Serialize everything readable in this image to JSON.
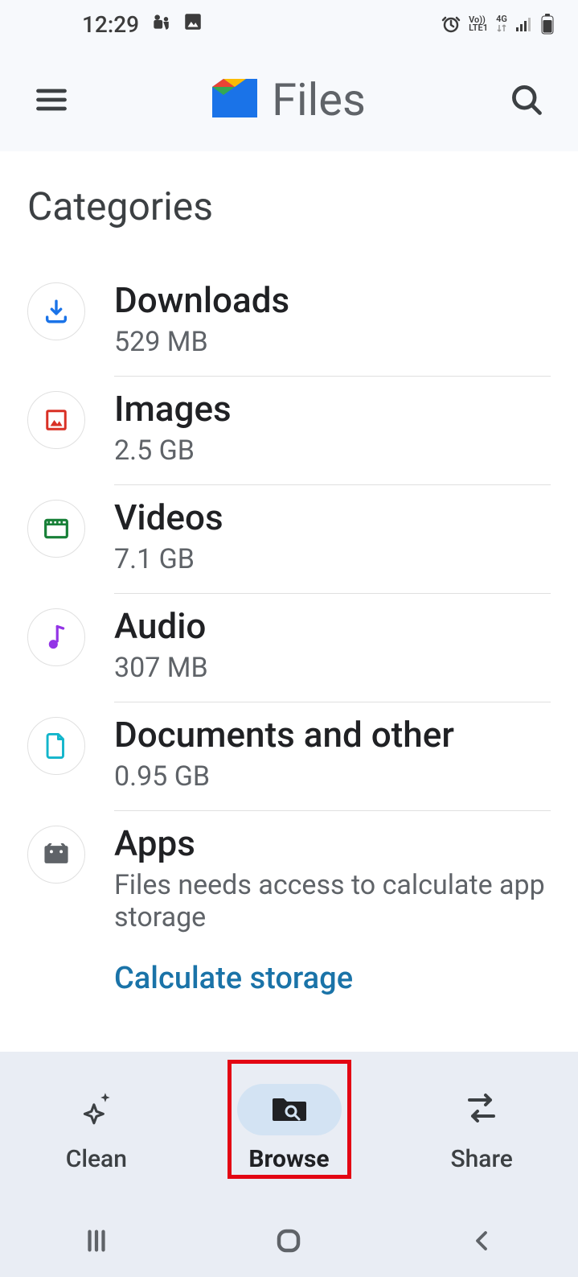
{
  "status": {
    "time": "12:29",
    "lte": "LTE1",
    "net": "4G",
    "volte": "Vo))"
  },
  "appbar": {
    "title": "Files"
  },
  "section_title": "Categories",
  "categories": [
    {
      "name": "Downloads",
      "subtitle": "529 MB"
    },
    {
      "name": "Images",
      "subtitle": "2.5 GB"
    },
    {
      "name": "Videos",
      "subtitle": "7.1 GB"
    },
    {
      "name": "Audio",
      "subtitle": "307 MB"
    },
    {
      "name": "Documents and other",
      "subtitle": "0.95 GB"
    },
    {
      "name": "Apps",
      "subtitle": "Files needs access to calculate app storage"
    }
  ],
  "calc_link": "Calculate storage",
  "nav": {
    "clean": "Clean",
    "browse": "Browse",
    "share": "Share"
  }
}
